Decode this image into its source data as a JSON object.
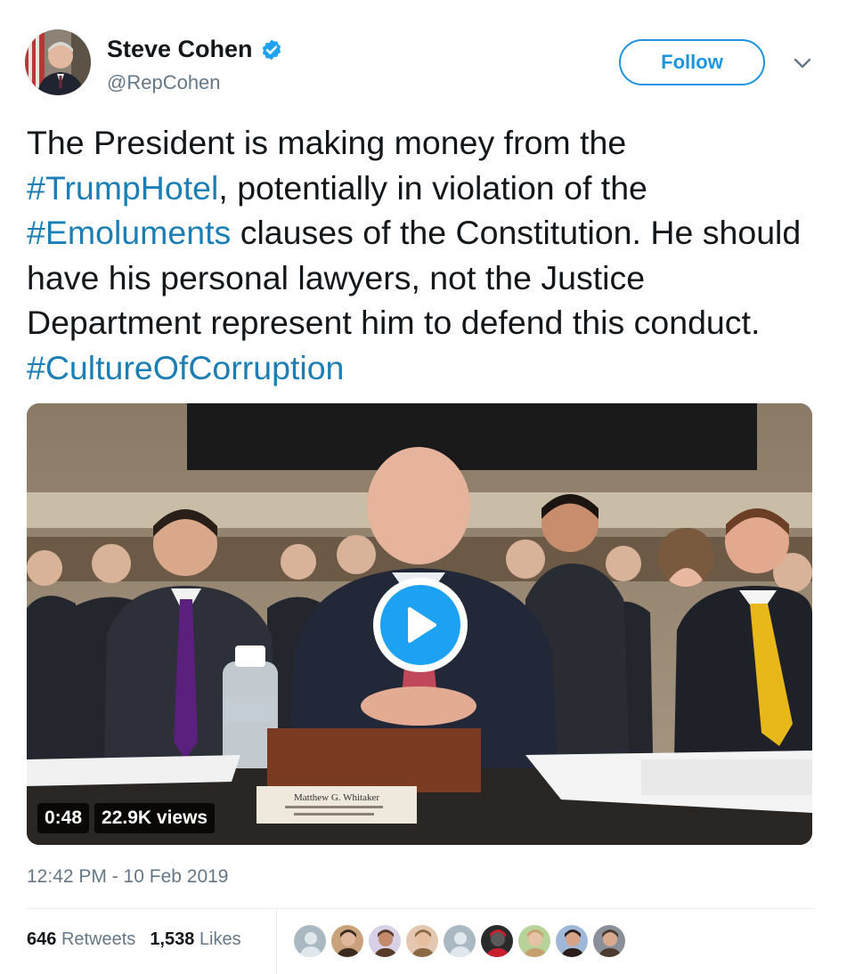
{
  "author": {
    "display_name": "Steve Cohen",
    "handle": "@RepCohen",
    "verified": true,
    "avatar_icon": "user-avatar-photo"
  },
  "header": {
    "follow_label": "Follow",
    "menu_icon": "chevron-down-icon"
  },
  "tweet": {
    "segments": [
      {
        "text": "The President is making money from the ",
        "hashtag": false
      },
      {
        "text": "#TrumpHotel",
        "hashtag": true
      },
      {
        "text": ", potentially in violation of the ",
        "hashtag": false
      },
      {
        "text": "#Emoluments",
        "hashtag": true
      },
      {
        "text": " clauses of the Constitution. He should have his personal lawyers, not the Justice Department represent him to defend this conduct. ",
        "hashtag": false
      },
      {
        "text": "#CultureOfCorruption",
        "hashtag": true
      }
    ]
  },
  "media": {
    "duration": "0:48",
    "views": "22.9K views",
    "play_icon": "play-icon",
    "nameplate": "Matthew G. Whitaker"
  },
  "timestamp": "12:42 PM - 10 Feb 2019",
  "stats": {
    "retweets_count": "646",
    "retweets_label": "Retweets",
    "likes_count": "1,538",
    "likes_label": "Likes"
  },
  "likers": [
    "default",
    "photo",
    "photo",
    "photo",
    "default",
    "photo",
    "photo",
    "photo",
    "photo"
  ],
  "colors": {
    "accent": "#1da1f2",
    "hashtag": "#1b7fb5",
    "secondary_text": "#657786",
    "divider": "#e6ecf0"
  }
}
